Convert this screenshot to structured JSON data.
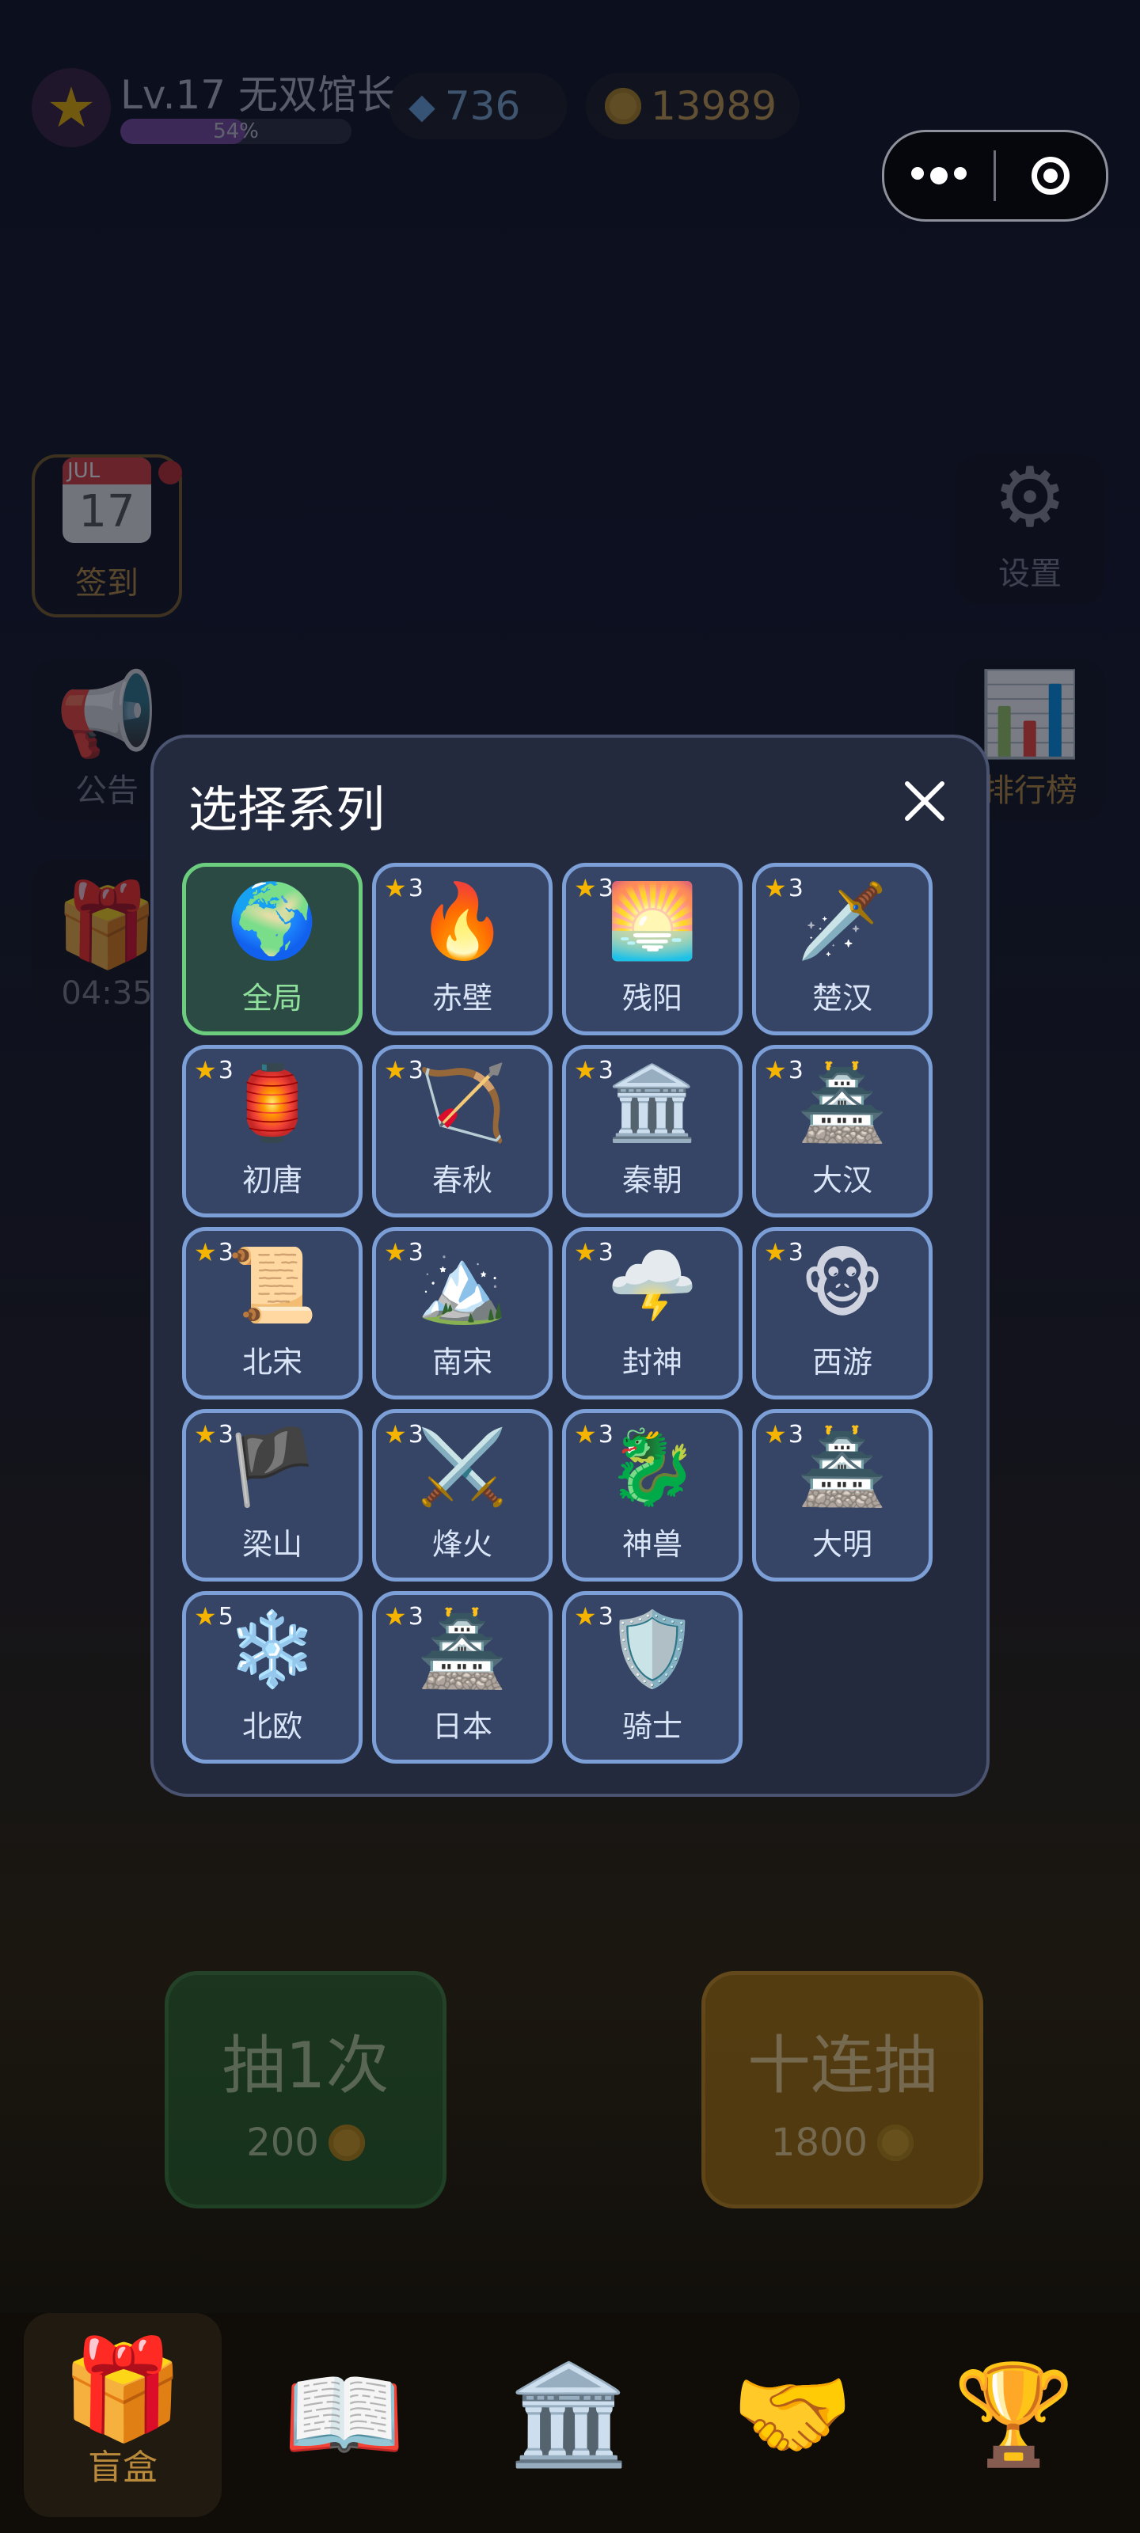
{
  "header": {
    "level_text": "Lv.17 无双馆长",
    "xp_text": "54%",
    "xp_fraction": 0.54,
    "gems": "736",
    "coins": "13989"
  },
  "side_left": {
    "checkin_label": "签到",
    "notice_label": "公告",
    "gift_timer": "04:35"
  },
  "side_right": {
    "settings_label": "设置",
    "rank_label": "排行榜"
  },
  "calendar_icon": {
    "month": "JUL",
    "day": "17"
  },
  "modal": {
    "title": "选择系列",
    "items": [
      {
        "name": "全局",
        "icon": "🌍",
        "stars": "",
        "active": true,
        "slug": "global"
      },
      {
        "name": "赤壁",
        "icon": "🔥",
        "stars": "3",
        "slug": "chibi"
      },
      {
        "name": "残阳",
        "icon": "🌅",
        "stars": "3",
        "slug": "canyang"
      },
      {
        "name": "楚汉",
        "icon": "🗡️",
        "stars": "3",
        "slug": "chuhan"
      },
      {
        "name": "初唐",
        "icon": "🏮",
        "stars": "3",
        "slug": "chutang"
      },
      {
        "name": "春秋",
        "icon": "🏹",
        "stars": "3",
        "slug": "chunqiu"
      },
      {
        "name": "秦朝",
        "icon": "🏛️",
        "stars": "3",
        "slug": "qinchao"
      },
      {
        "name": "大汉",
        "icon": "🏯",
        "stars": "3",
        "slug": "dahan"
      },
      {
        "name": "北宋",
        "icon": "📜",
        "stars": "3",
        "slug": "beisong"
      },
      {
        "name": "南宋",
        "icon": "🏔️",
        "stars": "3",
        "slug": "nansong"
      },
      {
        "name": "封神",
        "icon": "🌩️",
        "stars": "3",
        "slug": "fengshen"
      },
      {
        "name": "西游",
        "icon": "🐵",
        "stars": "3",
        "slug": "xiyou"
      },
      {
        "name": "梁山",
        "icon": "🏴",
        "stars": "3",
        "slug": "liangshan"
      },
      {
        "name": "烽火",
        "icon": "⚔️",
        "stars": "3",
        "slug": "fenghuo"
      },
      {
        "name": "神兽",
        "icon": "🐉",
        "stars": "3",
        "slug": "shenshou"
      },
      {
        "name": "大明",
        "icon": "🏯",
        "stars": "3",
        "slug": "daming"
      },
      {
        "name": "北欧",
        "icon": "❄️",
        "stars": "5",
        "slug": "beiou"
      },
      {
        "name": "日本",
        "icon": "🏯",
        "stars": "3",
        "slug": "riben"
      },
      {
        "name": "骑士",
        "icon": "🛡️",
        "stars": "3",
        "slug": "qishi"
      }
    ]
  },
  "draw": {
    "one_label": "抽1次",
    "one_price": "200",
    "ten_label": "十连抽",
    "ten_price": "1800"
  },
  "nav": {
    "blindbox_label": "盲盒"
  },
  "colors": {
    "active_border": "#6ccd7f",
    "card_border": "#7c9fd8",
    "star": "#f4b400",
    "coin": "#c99a2e"
  }
}
